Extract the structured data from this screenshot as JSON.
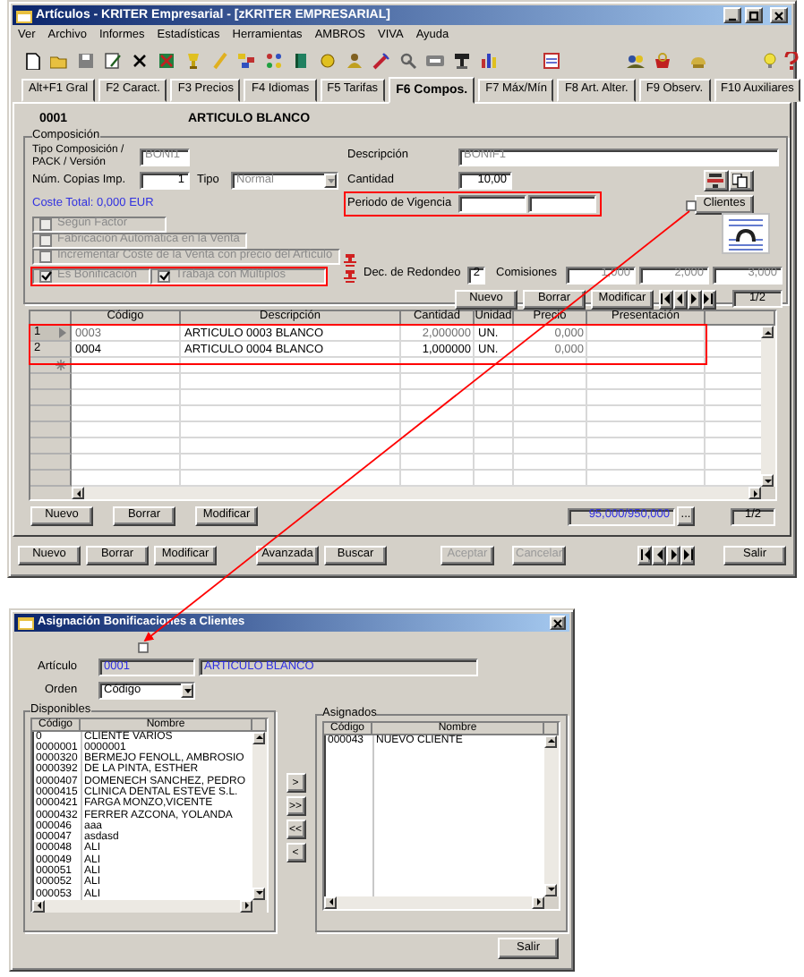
{
  "window": {
    "title": "Artículos - KRITER Empresarial - [zKRITER EMPRESARIAL]"
  },
  "menu": [
    "Ver",
    "Archivo",
    "Informes",
    "Estadísticas",
    "Herramientas",
    "AMBROS",
    "VIVA",
    "Ayuda"
  ],
  "tabs": [
    {
      "label": "Alt+F1 Gral",
      "selected": false
    },
    {
      "label": "F2 Caract.",
      "selected": false
    },
    {
      "label": "F3 Precios",
      "selected": false
    },
    {
      "label": "F4 Idiomas",
      "selected": false
    },
    {
      "label": "F5 Tarifas",
      "selected": false
    },
    {
      "label": "F6 Compos.",
      "selected": true
    },
    {
      "label": "F7 Máx/Mín",
      "selected": false
    },
    {
      "label": "F8 Art. Alter.",
      "selected": false
    },
    {
      "label": "F9 Observ.",
      "selected": false
    },
    {
      "label": "F10 Auxiliares",
      "selected": false
    }
  ],
  "article": {
    "code": "0001",
    "name": "ARTICULO BLANCO"
  },
  "composition": {
    "legend": "Composición",
    "type_label": "Tipo Composición / PACK / Versión",
    "type_value": "BONI1",
    "description_label": "Descripción",
    "description_value": "BONIF1",
    "copies_label": "Núm. Copias Imp.",
    "copies_value": "1",
    "tipo_label": "Tipo",
    "tipo_value": "Normal",
    "quantity_label": "Cantidad",
    "quantity_value": "10,00",
    "total_cost": "Coste Total: 0,000 EUR",
    "validity_label": "Periodo de Vigencia",
    "clients_button": "Clientes",
    "checkboxes": [
      {
        "label": "Según Factor",
        "checked": false,
        "disabled": true
      },
      {
        "label": "Fabricación Automática en la Venta",
        "checked": false,
        "disabled": true
      },
      {
        "label": "Incrementar Coste de la Venta con precio del Artículo",
        "checked": false,
        "disabled": true
      },
      {
        "label": "Es Bonificación",
        "checked": true,
        "disabled": true
      },
      {
        "label": "Trabaja con Múltiplos",
        "checked": true,
        "disabled": true
      }
    ],
    "rounding_label": "Dec. de Redondeo",
    "rounding_value": "2",
    "commissions_label": "Comisiones",
    "commissions": [
      "1,000",
      "2,000",
      "3,000"
    ],
    "buttons": [
      "Nuevo",
      "Borrar",
      "Modificar"
    ],
    "page": "1/2"
  },
  "lines": {
    "columns": [
      "Código",
      "Descripción",
      "Cantidad",
      "Unidad",
      "Precio",
      "Presentación"
    ],
    "rows": [
      {
        "number": "1",
        "selected": true,
        "cells": [
          "0003",
          "ARTICULO 0003 BLANCO",
          "2,000000",
          "UN.",
          "0,000"
        ]
      },
      {
        "number": "2",
        "selected": false,
        "cells": [
          "0004",
          "ARTICULO 0004 BLANCO",
          "1,000000",
          "UN.",
          "0,000"
        ]
      }
    ],
    "buttons": [
      "Nuevo",
      "Borrar",
      "Modificar"
    ],
    "total": "95,000/950,000",
    "more_button": "...",
    "page": "1/2"
  },
  "actions": [
    {
      "label": "Nuevo",
      "disabled": false
    },
    {
      "label": "Borrar",
      "disabled": false
    },
    {
      "label": "Modificar",
      "disabled": false
    },
    {
      "label": "Avanzada",
      "disabled": false
    },
    {
      "label": "Buscar",
      "disabled": false
    },
    {
      "label": "Aceptar",
      "disabled": true
    },
    {
      "label": "Cancelar",
      "disabled": true
    }
  ],
  "exit_button": "Salir",
  "dialog": {
    "title": "Asignación Bonificaciones a Clientes",
    "article_label": "Artículo",
    "article_code": "0001",
    "article_name": "ARTICULO BLANCO",
    "order_label": "Orden",
    "order_value": "Código",
    "available": {
      "legend": "Disponibles",
      "columns": [
        "Código",
        "Nombre"
      ],
      "rows": [
        [
          "0",
          "CLIENTE VARIOS"
        ],
        [
          "0000001",
          "0000001"
        ],
        [
          "0000320",
          "BERMEJO FENOLL, AMBROSIO"
        ],
        [
          "0000392",
          "DE LA PINTA, ESTHER"
        ],
        [
          "0000407",
          "DOMENECH SANCHEZ, PEDRO"
        ],
        [
          "0000415",
          "CLINICA DENTAL ESTEVE S.L."
        ],
        [
          "0000421",
          "FARGA MONZO,VICENTE"
        ],
        [
          "0000432",
          "FERRER AZCONA, YOLANDA"
        ],
        [
          "000046",
          "aaa"
        ],
        [
          "000047",
          "asdasd"
        ],
        [
          "000048",
          "ALI"
        ],
        [
          "000049",
          "ALI"
        ],
        [
          "000051",
          "ALI"
        ],
        [
          "000052",
          "ALI"
        ],
        [
          "000053",
          "ALI"
        ]
      ]
    },
    "assigned": {
      "legend": "Asignados",
      "columns": [
        "Código",
        "Nombre"
      ],
      "rows": [
        [
          "000043",
          "NUEVO CLIENTE"
        ]
      ]
    },
    "transfer_buttons": [
      ">",
      ">>",
      "<<",
      "<"
    ],
    "close_button": "Salir"
  }
}
